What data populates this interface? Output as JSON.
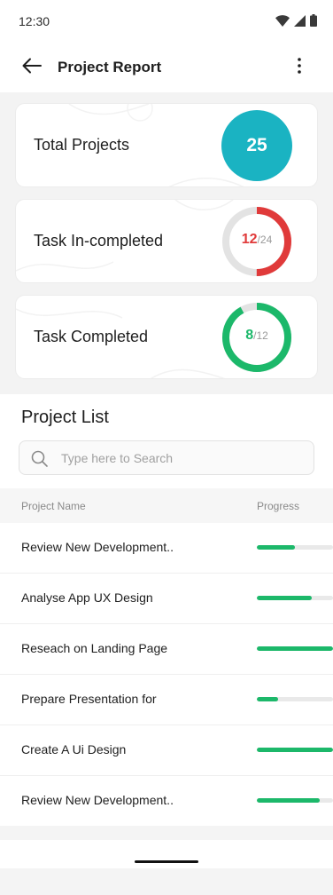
{
  "status_bar": {
    "time": "12:30",
    "icons": [
      "wifi-icon",
      "cellular-signal-icon",
      "battery-icon"
    ]
  },
  "header": {
    "title": "Project Report",
    "back_icon": "arrow-left-icon",
    "menu_icon": "more-vertical-icon"
  },
  "stats": {
    "total": {
      "label": "Total Projects",
      "value": "25",
      "color": "#1ab3c2"
    },
    "incomplete": {
      "label": "Task In-completed",
      "value": "12",
      "separator": "/",
      "total": "24",
      "progress": 0.5,
      "color": "#e03a3a"
    },
    "completed": {
      "label": "Task Completed",
      "value": "8",
      "separator": "/",
      "total": "12",
      "progress": 0.92,
      "color": "#1cb86a"
    }
  },
  "project_list": {
    "title": "Project List",
    "search": {
      "placeholder": "Type here to Search",
      "icon": "search-icon"
    },
    "columns": {
      "name": "Project Name",
      "progress": "Progress"
    },
    "rows": [
      {
        "name": "Review New Development..",
        "progress": 0.5
      },
      {
        "name": "Analyse App UX Design",
        "progress": 0.72
      },
      {
        "name": "Reseach on Landing Page",
        "progress": 1.0
      },
      {
        "name": "Prepare Presentation for",
        "progress": 0.28
      },
      {
        "name": "Create A Ui Design",
        "progress": 1.0
      },
      {
        "name": "Review New Development..",
        "progress": 0.82
      }
    ]
  },
  "colors": {
    "accent_teal": "#1ab3c2",
    "progress_green": "#1cb86a",
    "alert_red": "#e03a3a",
    "ring_track": "#e3e3e3"
  }
}
